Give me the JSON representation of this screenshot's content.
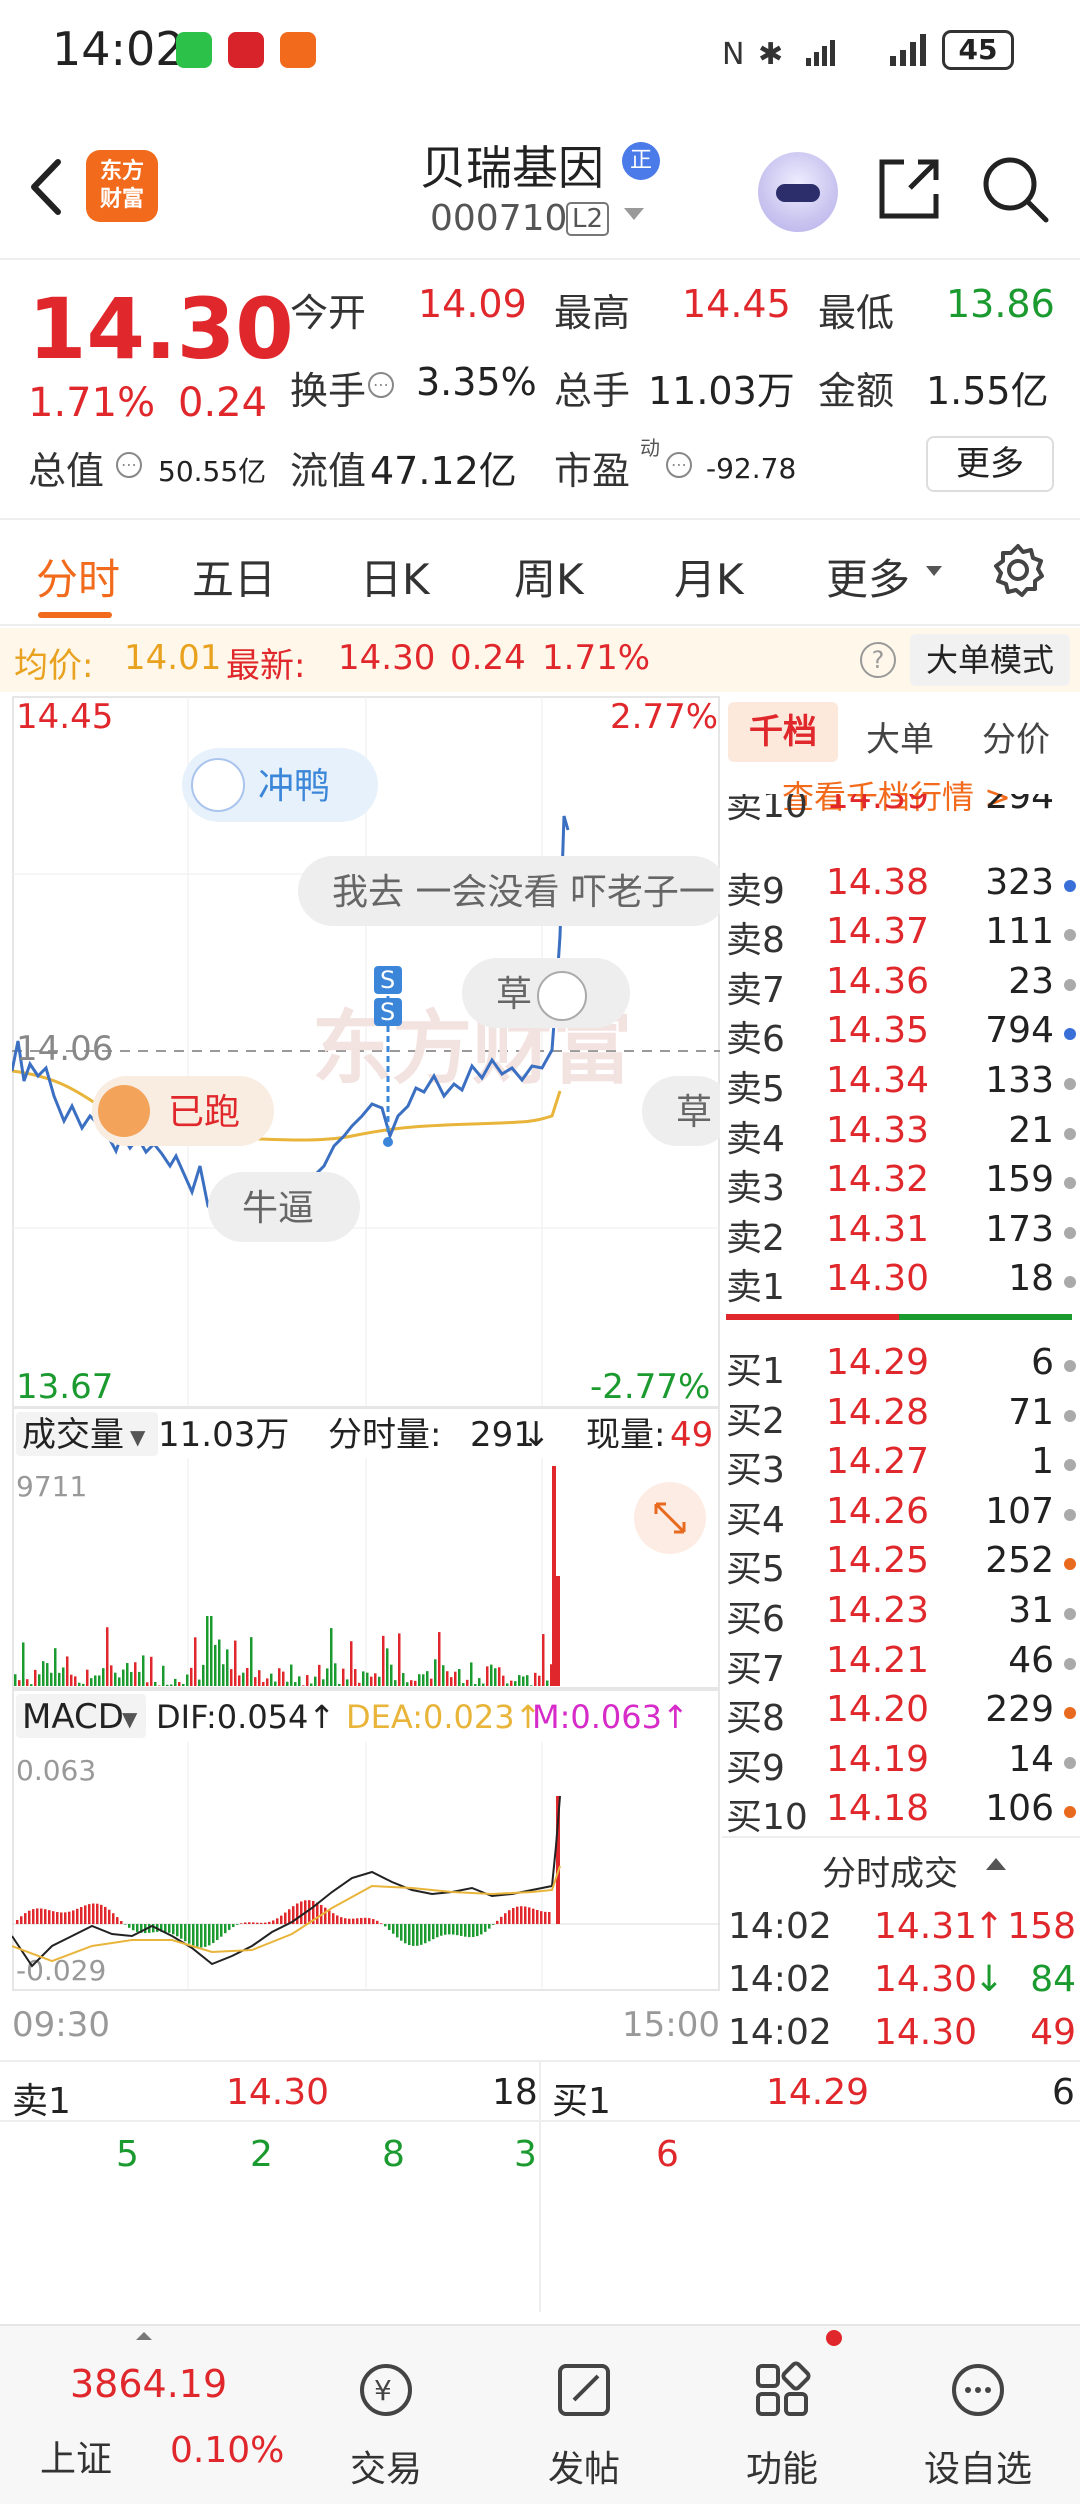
{
  "status_bar": {
    "time": "14:02",
    "battery": "45"
  },
  "header": {
    "logo_text_1": "东方",
    "logo_text_2": "财富",
    "stock_name": "贝瑞基因",
    "name_badge": "正",
    "stock_code": "000710",
    "level_badge": "L2"
  },
  "quote": {
    "last_price": "14.30",
    "pct_change": "1.71%",
    "abs_change": "0.24",
    "open_label": "今开",
    "open": "14.09",
    "high_label": "最高",
    "high": "14.45",
    "low_label": "最低",
    "low": "13.86",
    "turnover_label": "换手",
    "turnover": "3.35%",
    "volume_label": "总手",
    "volume": "11.03万",
    "amount_label": "金额",
    "amount": "1.55亿",
    "mktcap_label": "总值",
    "mktcap": "50.55亿",
    "float_label": "流值",
    "float": "47.12亿",
    "pe_label": "市盈",
    "pe_sup": "动",
    "pe": "-92.78",
    "more_label": "更多"
  },
  "tabs": [
    "分时",
    "五日",
    "日K",
    "周K",
    "月K",
    "更多"
  ],
  "avg_bar": {
    "avg_label": "均价:",
    "avg": "14.01",
    "latest_label": "最新:",
    "latest": "14.30",
    "chg": "0.24",
    "pct": "1.71%",
    "big_order_mode": "大单模式"
  },
  "intraday": {
    "y_top": "14.45",
    "y_top_pct": "2.77%",
    "y_bottom": "13.67",
    "y_bottom_pct": "-2.77%",
    "prev_close": "14.06",
    "comments": [
      "冲鸭",
      "我去 一会没看 吓老子一",
      "草",
      "已跑",
      "草",
      "牛逼"
    ],
    "signal_mark": "S"
  },
  "volume_panel": {
    "indicator": "成交量",
    "total": "11.03万",
    "tick_label": "分时量:",
    "tick": "291",
    "tick_dir": "↓",
    "now_label": "现量:",
    "now": "49",
    "y_max": "9711"
  },
  "macd_panel": {
    "indicator": "MACD",
    "dif": "DIF:0.054↑",
    "dea": "DEA:0.023↑",
    "m": "M:0.063↑",
    "y_max": "0.063",
    "y_min": "-0.029",
    "time_start": "09:30",
    "time_end": "15:00"
  },
  "order_book": {
    "tabs": [
      "千档",
      "大单",
      "分价"
    ],
    "view_link": "查看千档行情 >",
    "asks": [
      {
        "label": "卖10",
        "price": "14.39",
        "vol": "294"
      },
      {
        "label": "卖9",
        "price": "14.38",
        "vol": "323",
        "dot": "#3a6fd8"
      },
      {
        "label": "卖8",
        "price": "14.37",
        "vol": "111",
        "dot": "#aaaaaa"
      },
      {
        "label": "卖7",
        "price": "14.36",
        "vol": "23",
        "dot": "#aaaaaa"
      },
      {
        "label": "卖6",
        "price": "14.35",
        "vol": "794",
        "dot": "#3a6fd8"
      },
      {
        "label": "卖5",
        "price": "14.34",
        "vol": "133",
        "dot": "#aaaaaa"
      },
      {
        "label": "卖4",
        "price": "14.33",
        "vol": "21",
        "dot": "#aaaaaa"
      },
      {
        "label": "卖3",
        "price": "14.32",
        "vol": "159",
        "dot": "#aaaaaa"
      },
      {
        "label": "卖2",
        "price": "14.31",
        "vol": "173",
        "dot": "#aaaaaa"
      },
      {
        "label": "卖1",
        "price": "14.30",
        "vol": "18",
        "dot": "#aaaaaa"
      }
    ],
    "bids": [
      {
        "label": "买1",
        "price": "14.29",
        "vol": "6",
        "dot": "#aaaaaa"
      },
      {
        "label": "买2",
        "price": "14.28",
        "vol": "71",
        "dot": "#aaaaaa"
      },
      {
        "label": "买3",
        "price": "14.27",
        "vol": "1",
        "dot": "#aaaaaa"
      },
      {
        "label": "买4",
        "price": "14.26",
        "vol": "107",
        "dot": "#aaaaaa"
      },
      {
        "label": "买5",
        "price": "14.25",
        "vol": "252",
        "dot": "#e86a1f"
      },
      {
        "label": "买6",
        "price": "14.23",
        "vol": "31",
        "dot": "#aaaaaa"
      },
      {
        "label": "买7",
        "price": "14.21",
        "vol": "46",
        "dot": "#aaaaaa"
      },
      {
        "label": "买8",
        "price": "14.20",
        "vol": "229",
        "dot": "#e86a1f"
      },
      {
        "label": "买9",
        "price": "14.19",
        "vol": "14",
        "dot": "#aaaaaa"
      },
      {
        "label": "买10",
        "price": "14.18",
        "vol": "106",
        "dot": "#e86a1f"
      }
    ],
    "trades_header": "分时成交",
    "trades": [
      {
        "time": "14:02",
        "price": "14.31",
        "dir": "↑",
        "vol": "158",
        "vol_color": "#e0272b"
      },
      {
        "time": "14:02",
        "price": "14.30",
        "dir": "↓",
        "vol": "84",
        "vol_color": "#1b9a2f"
      },
      {
        "time": "14:02",
        "price": "14.30",
        "dir": "",
        "vol": "49",
        "vol_color": "#e0272b"
      }
    ]
  },
  "tape": {
    "ask_label": "卖1",
    "ask_price": "14.30",
    "ask_vol": "18",
    "bid_label": "买1",
    "bid_price": "14.29",
    "bid_vol": "6",
    "ask_queue": [
      "5",
      "2",
      "8",
      "3"
    ],
    "bid_queue": [
      "6"
    ]
  },
  "bottom_nav": {
    "index_value": "3864.19",
    "index_name": "上证",
    "index_pct": "0.10%",
    "items": [
      "交易",
      "发帖",
      "功能",
      "设自选"
    ]
  },
  "colors": {
    "up": "#e0272b",
    "down": "#1b9a2f",
    "accent": "#f26a1b",
    "price_line": "#3b6fc2",
    "avg_line": "#e8b43a"
  }
}
